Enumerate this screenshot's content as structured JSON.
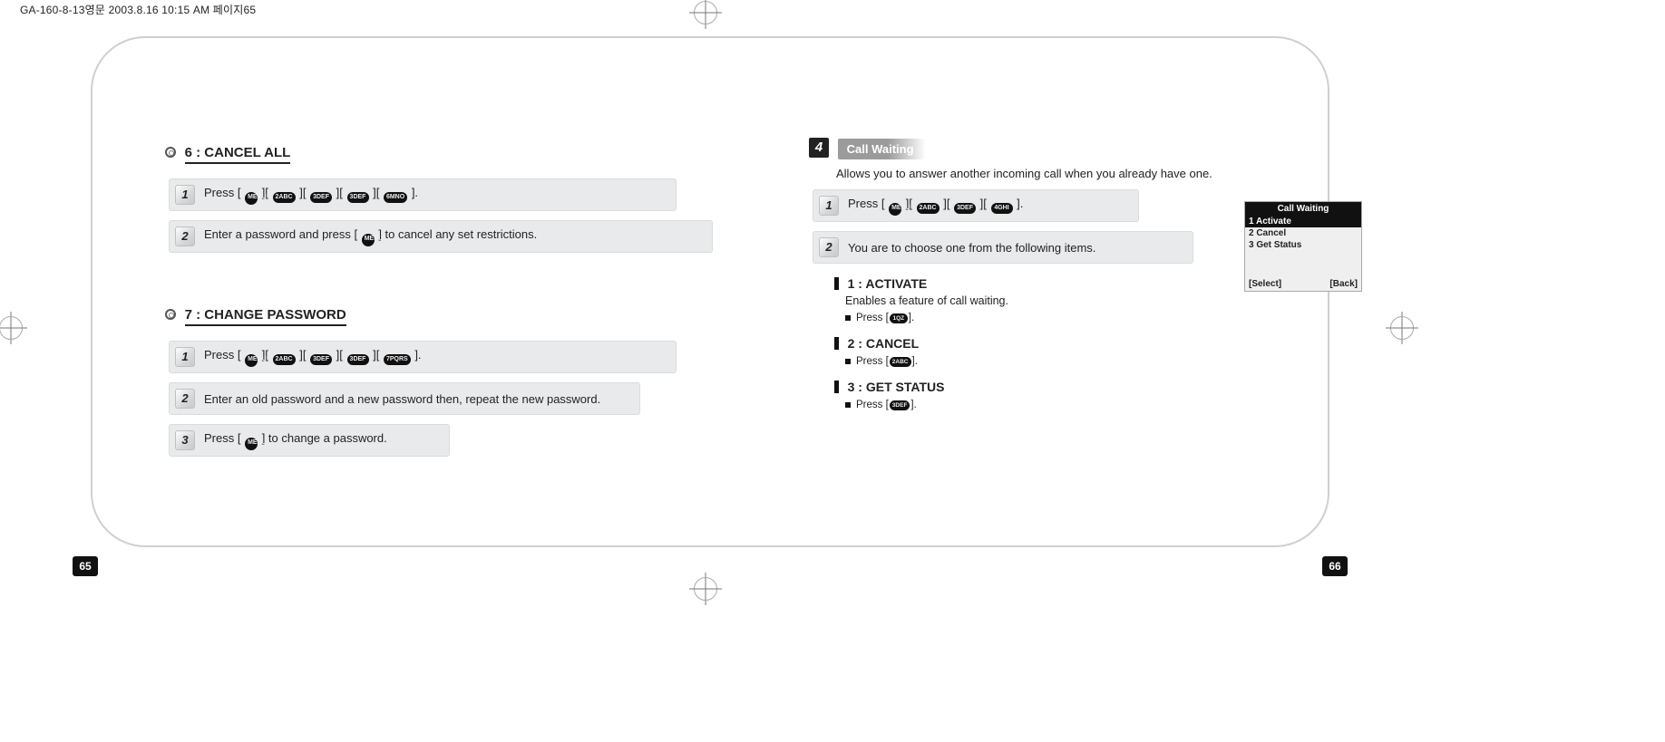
{
  "print_header": "GA-160-8-13영문   2003.8.16 10:15 AM   페이지65",
  "left": {
    "section6": {
      "title": "6 : CANCEL ALL",
      "steps": {
        "s1": {
          "num": "1",
          "before": "Press [ ",
          "keys": [
            "M",
            "2",
            "3",
            "3",
            "6"
          ],
          "after": " ]."
        },
        "s2": {
          "num": "2",
          "before": "Enter a password and press [ ",
          "keys": [
            "M"
          ],
          "after": " ] to cancel any set restrictions."
        }
      }
    },
    "section7": {
      "title": "7 : CHANGE PASSWORD",
      "steps": {
        "s1": {
          "num": "1",
          "before": "Press [ ",
          "keys": [
            "M",
            "2",
            "3",
            "3",
            "7"
          ],
          "after": " ]."
        },
        "s2": {
          "num": "2",
          "text": "Enter an old password and a new password then, repeat the new password."
        },
        "s3": {
          "num": "3",
          "before": "Press [ ",
          "keys": [
            "M"
          ],
          "after": " ] to change a password."
        }
      }
    }
  },
  "right": {
    "index": "4",
    "title": "Call Waiting",
    "lead": "Allows you to answer another incoming call when you already have one.",
    "steps": {
      "s1": {
        "num": "1",
        "before": "Press [ ",
        "keys": [
          "M",
          "2",
          "3",
          "4"
        ],
        "after": " ]."
      },
      "s2": {
        "num": "2",
        "text": "You are to choose one from the following items."
      }
    },
    "items": {
      "i1": {
        "title": "1 : ACTIVATE",
        "desc": "Enables a feature of call waiting.",
        "press_before": "Press [ ",
        "press_key": "1",
        "press_after": " ]."
      },
      "i2": {
        "title": "2 : CANCEL",
        "press_before": "Press [ ",
        "press_key": "2",
        "press_after": " ]."
      },
      "i3": {
        "title": "3 : GET STATUS",
        "press_before": "Press [ ",
        "press_key": "3",
        "press_after": " ]."
      }
    },
    "phone": {
      "header": "Call Waiting",
      "rows": [
        "1 Activate",
        "2 Cancel",
        "3 Get Status"
      ],
      "footer_left": "[Select]",
      "footer_right": "[Back]"
    }
  },
  "page_left": "65",
  "page_right": "66",
  "key_labels": {
    "M": "MENU",
    "1": "1QZ",
    "2": "2ABC",
    "3": "3DEF",
    "4": "4GHI",
    "6": "6MNO",
    "7": "7PQRS"
  }
}
